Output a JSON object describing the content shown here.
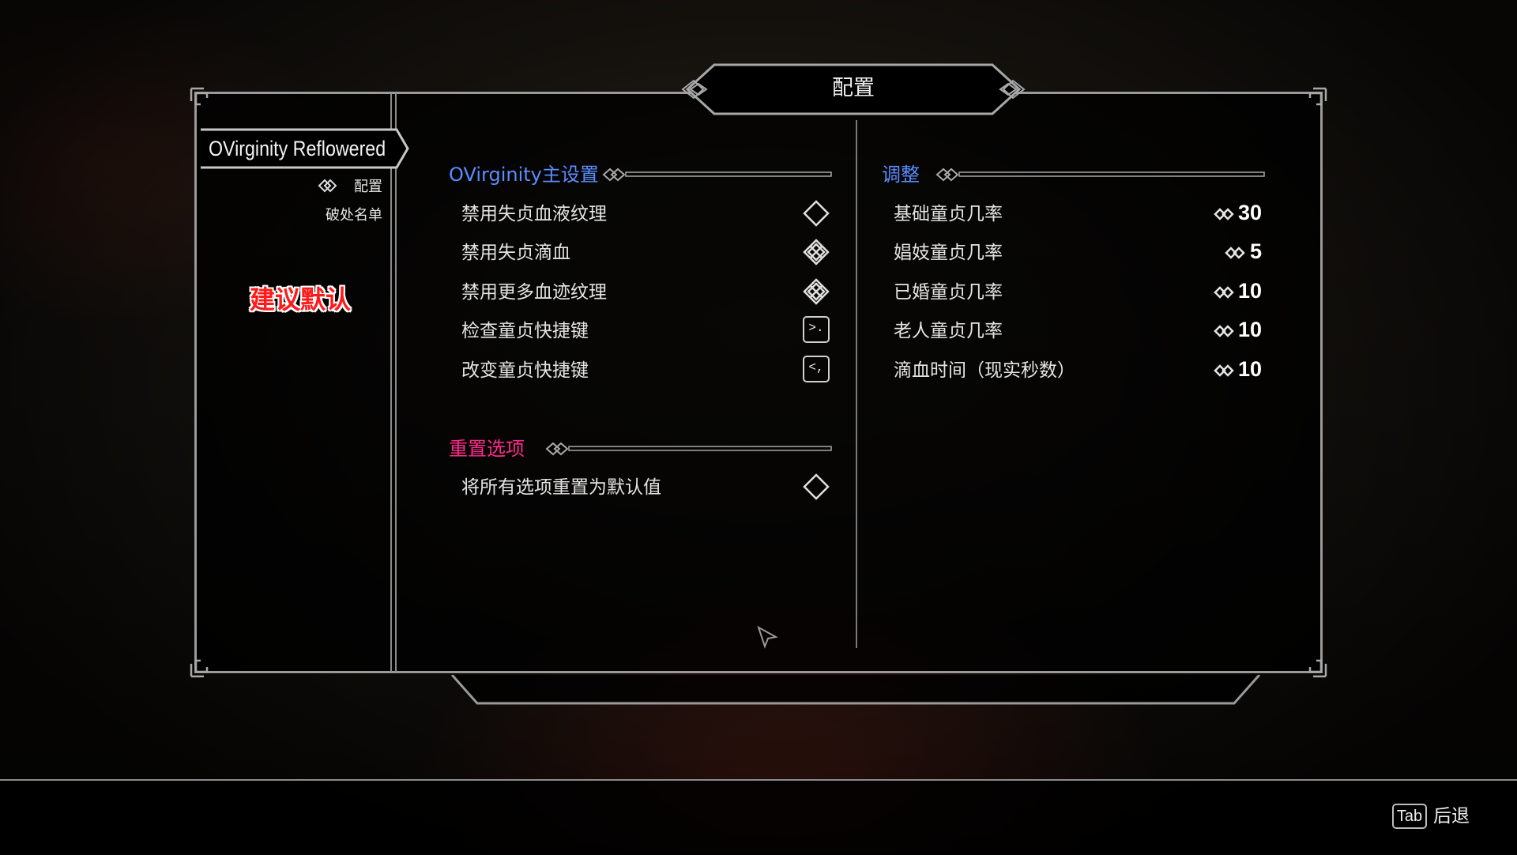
{
  "window": {
    "title": "配置"
  },
  "sidebar": {
    "mod_name": "OVirginity Reflowered",
    "pages": [
      {
        "label": "配置",
        "active": true
      },
      {
        "label": "破处名单",
        "active": false
      }
    ],
    "hint": "建议默认"
  },
  "left_column": {
    "main_header": "OVirginity主设置",
    "main_header_color": "#5b8cff",
    "main_options": [
      {
        "label": "禁用失贞血液纹理",
        "type": "toggle",
        "checked": false
      },
      {
        "label": "禁用失贞滴血",
        "type": "toggle",
        "checked": true
      },
      {
        "label": "禁用更多血迹纹理",
        "type": "toggle",
        "checked": true
      },
      {
        "label": "检查童贞快捷键",
        "type": "keymap",
        "key": ">."
      },
      {
        "label": "改变童贞快捷键",
        "type": "keymap",
        "key": "<,"
      }
    ],
    "reset_header": "重置选项",
    "reset_header_color": "#ff2a8a",
    "reset_options": [
      {
        "label": "将所有选项重置为默认值",
        "type": "toggle",
        "checked": false
      }
    ]
  },
  "right_column": {
    "header": "调整",
    "header_color": "#5b8cff",
    "sliders": [
      {
        "label": "基础童贞几率",
        "value": "30"
      },
      {
        "label": "娼妓童贞几率",
        "value": "5"
      },
      {
        "label": "已婚童贞几率",
        "value": "10"
      },
      {
        "label": "老人童贞几率",
        "value": "10"
      },
      {
        "label": "滴血时间（现实秒数）",
        "value": "10"
      }
    ]
  },
  "footer": {
    "back_key": "Tab",
    "back_label": "后退"
  },
  "icons": {
    "toggle_off": "diamond-outline-icon",
    "toggle_on": "knot-checked-icon",
    "keymap": "keycap-icon",
    "slider": "slider-arrows-icon",
    "section": "knot-icon"
  }
}
